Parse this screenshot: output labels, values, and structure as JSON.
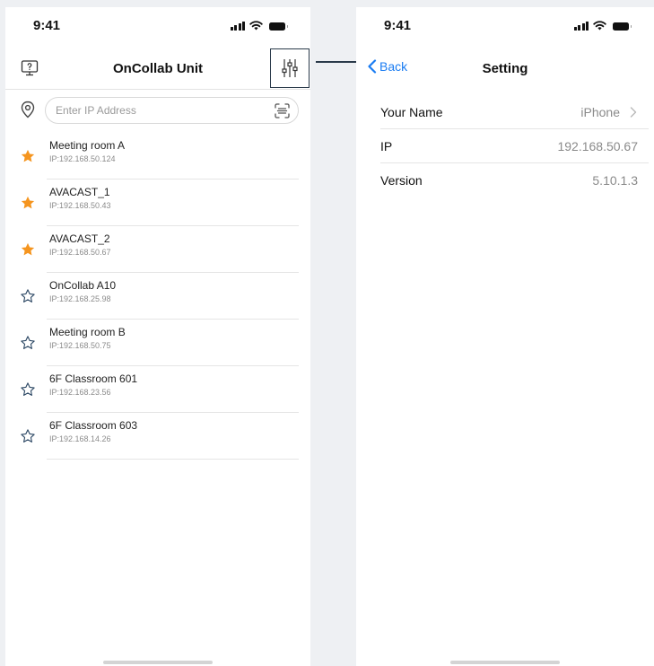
{
  "left_screen": {
    "status_bar": {
      "time": "9:41"
    },
    "header": {
      "title": "OnCollab Unit"
    },
    "search": {
      "placeholder": "Enter IP Address",
      "value": ""
    },
    "devices": [
      {
        "name": "Meeting room A",
        "ip": "IP:192.168.50.124",
        "favorite": true
      },
      {
        "name": "AVACAST_1",
        "ip": "IP:192.168.50.43",
        "favorite": true
      },
      {
        "name": "AVACAST_2",
        "ip": "IP:192.168.50.67",
        "favorite": true
      },
      {
        "name": "OnCollab A10",
        "ip": "IP:192.168.25.98",
        "favorite": false
      },
      {
        "name": "Meeting room B",
        "ip": "IP:192.168.50.75",
        "favorite": false
      },
      {
        "name": "6F Classroom 601",
        "ip": "IP:192.168.23.56",
        "favorite": false
      },
      {
        "name": "6F Classroom 603",
        "ip": "IP:192.168.14.26",
        "favorite": false
      }
    ]
  },
  "right_screen": {
    "status_bar": {
      "time": "9:41"
    },
    "header": {
      "back_label": "Back",
      "title": "Setting"
    },
    "rows": [
      {
        "label": "Your Name",
        "value": "iPhone",
        "chevron": true
      },
      {
        "label": "IP",
        "value": "192.168.50.67",
        "chevron": false
      },
      {
        "label": "Version",
        "value": "5.10.1.3",
        "chevron": false
      }
    ]
  },
  "colors": {
    "accent_blue": "#1a7cf2",
    "favorite_star": "#f5951f",
    "highlight_border": "#2a3a4a"
  },
  "icons": {
    "help": "help-monitor-icon",
    "settings": "sliders-icon",
    "location": "location-pin-icon",
    "scan": "scan-icon",
    "favorite": "star-filled-icon",
    "not_favorite": "star-outline-icon",
    "back": "chevron-left-icon",
    "row_more": "chevron-right-icon"
  }
}
